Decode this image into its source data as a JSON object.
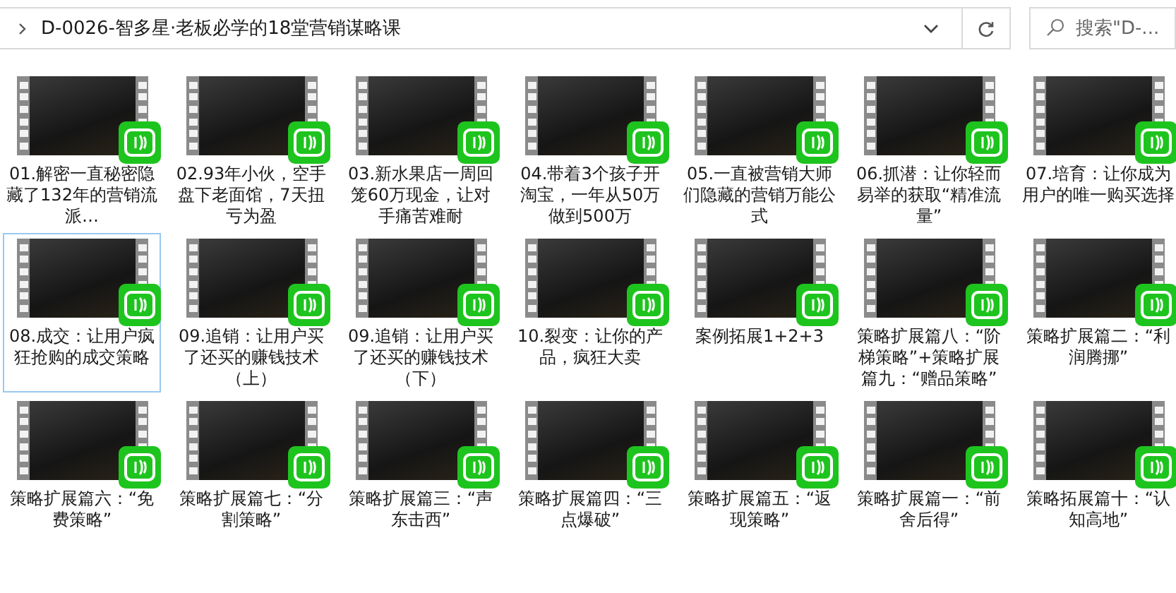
{
  "address_bar": {
    "path": [
      "D-0026-智多星·老板必学的18堂营销谋略课"
    ]
  },
  "search": {
    "placeholder": "搜索\"D-..."
  },
  "files": [
    {
      "name": "01.解密一直秘密隐藏了132年的营销流派…",
      "selected": false
    },
    {
      "name": "02.93年小伙，空手盘下老面馆，7天扭亏为盈",
      "selected": false
    },
    {
      "name": "03.新水果店一周回笼60万现金，让对手痛苦难耐",
      "selected": false
    },
    {
      "name": "04.带着3个孩子开淘宝，一年从50万做到500万",
      "selected": false
    },
    {
      "name": "05.一直被营销大师们隐藏的营销万能公式",
      "selected": false
    },
    {
      "name": "06.抓潜：让你轻而易举的获取“精准流量”",
      "selected": false
    },
    {
      "name": "07.培育：让你成为用户的唯一购买选择",
      "selected": false
    },
    {
      "name": "08.成交：让用户疯狂抢购的成交策略",
      "selected": true
    },
    {
      "name": "09.追销：让用户买了还买的赚钱技术（上）",
      "selected": false
    },
    {
      "name": "09.追销：让用户买了还买的赚钱技术（下）",
      "selected": false
    },
    {
      "name": "10.裂变：让你的产品，疯狂大卖",
      "selected": false
    },
    {
      "name": "案例拓展1+2+3",
      "selected": false
    },
    {
      "name": "策略扩展篇八：“阶梯策略”+策略扩展篇九：“赠品策略”",
      "selected": false
    },
    {
      "name": "策略扩展篇二：“利润腾挪”",
      "selected": false
    },
    {
      "name": "策略扩展篇六：“免费策略”",
      "selected": false
    },
    {
      "name": "策略扩展篇七：“分割策略”",
      "selected": false
    },
    {
      "name": "策略扩展篇三：“声东击西”",
      "selected": false
    },
    {
      "name": "策略扩展篇四：“三点爆破”",
      "selected": false
    },
    {
      "name": "策略扩展篇五：“返现策略”",
      "selected": false
    },
    {
      "name": "策略扩展篇一：“前舍后得”",
      "selected": false
    },
    {
      "name": "策略拓展篇十：“认知高地”",
      "selected": false
    }
  ]
}
